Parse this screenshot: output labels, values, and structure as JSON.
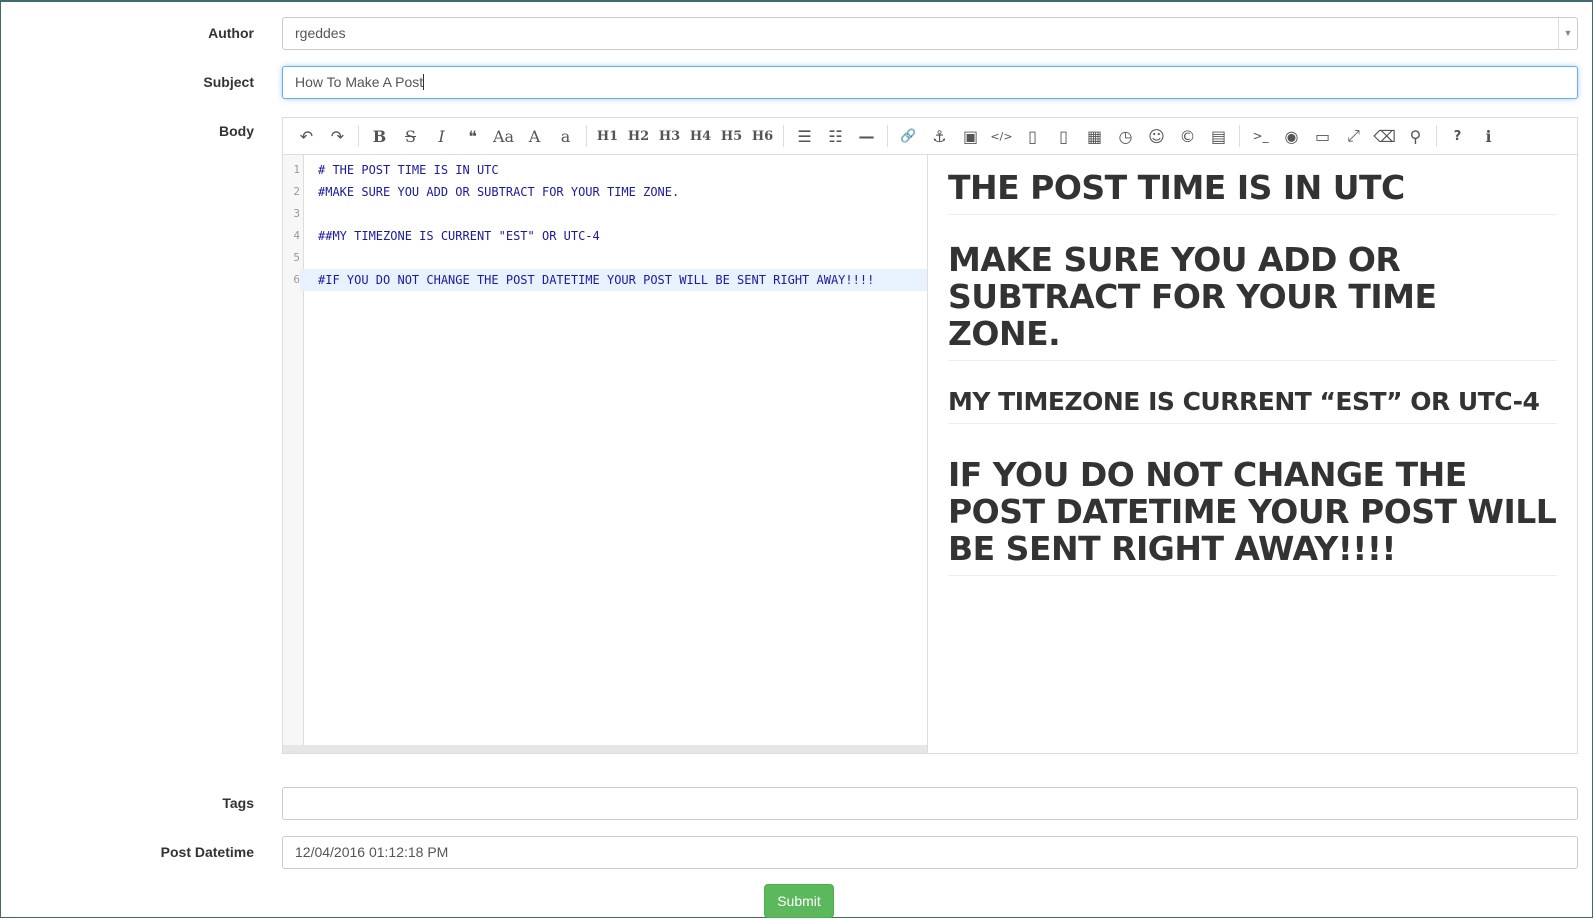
{
  "form": {
    "author_label": "Author",
    "author_value": "rgeddes",
    "subject_label": "Subject",
    "subject_value": "How To Make A Post",
    "body_label": "Body",
    "tags_label": "Tags",
    "tags_value": "",
    "datetime_label": "Post Datetime",
    "datetime_value": "12/04/2016 01:12:18 PM",
    "submit_label": "Submit"
  },
  "toolbar": {
    "undo": "↶",
    "redo": "↷",
    "bold": "B",
    "strike": "S",
    "italic": "I",
    "quote": "❝",
    "uppercase": "Aa",
    "upper": "A",
    "lower": "a",
    "h1": "H1",
    "h2": "H2",
    "h3": "H3",
    "h4": "H4",
    "h5": "H5",
    "h6": "H6",
    "ul": "☰",
    "ol": "☷",
    "hr": "—",
    "link": "🔗",
    "anchor": "⚓",
    "image": "▣",
    "code": "</>",
    "code_block": "▯",
    "code_block2": "▯",
    "table": "▦",
    "datetime": "◷",
    "emoji": "☺",
    "html_entity": "©",
    "toc": "▤",
    "terminal": ">_",
    "preview": "◉",
    "watch": "▭",
    "fullscreen": "⤢",
    "clear": "⌫",
    "search": "⚲",
    "help": "?",
    "info": "ℹ"
  },
  "editor": {
    "lines": [
      {
        "num": "1",
        "text": "# THE POST TIME IS IN UTC"
      },
      {
        "num": "2",
        "text": "#MAKE SURE YOU ADD OR SUBTRACT FOR YOUR TIME ZONE."
      },
      {
        "num": "3",
        "text": ""
      },
      {
        "num": "4",
        "text": "##MY TIMEZONE IS CURRENT \"EST\" OR UTC-4"
      },
      {
        "num": "5",
        "text": ""
      },
      {
        "num": "6",
        "text": "#IF YOU DO NOT CHANGE THE POST DATETIME YOUR POST WILL BE SENT RIGHT AWAY!!!!"
      }
    ]
  },
  "preview": {
    "h1_a": "THE POST TIME IS IN UTC",
    "h1_b": "MAKE SURE YOU ADD OR SUBTRACT FOR YOUR TIME ZONE.",
    "h2_a": "MY TIMEZONE IS CURRENT “EST” OR UTC-4",
    "h1_c": "IF YOU DO NOT CHANGE THE POST DATETIME YOUR POST WILL BE SENT RIGHT AWAY!!!!"
  },
  "colors": {
    "accent_focus": "#66afe9",
    "submit_green": "#5cb85c",
    "code_text": "#1a1aa6"
  }
}
